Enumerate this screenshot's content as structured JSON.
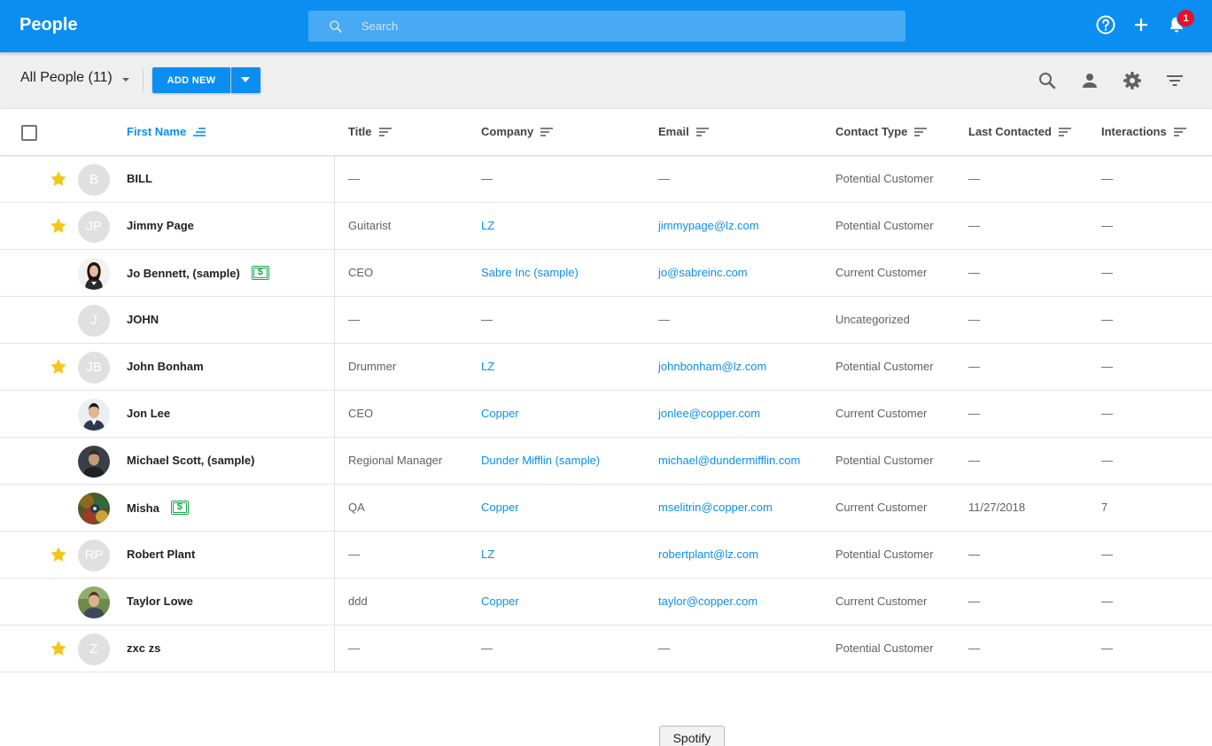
{
  "app": {
    "title": "People"
  },
  "search": {
    "placeholder": "Search"
  },
  "notifications": {
    "count": "1"
  },
  "toolbar": {
    "view_label": "All People (11)",
    "add_new_label": "ADD NEW"
  },
  "columns": {
    "first_name": "First Name",
    "title": "Title",
    "company": "Company",
    "email": "Email",
    "contact_type": "Contact Type",
    "last_contacted": "Last Contacted",
    "interactions": "Interactions"
  },
  "colors": {
    "brand": "#0b8ef2",
    "star": "#f5c518",
    "money": "#17a84a",
    "badge": "#e8102c"
  },
  "rows": [
    {
      "starred": true,
      "initials": "B",
      "photo": null,
      "name": "BILL",
      "deal": false,
      "title": "—",
      "company": "—",
      "email": "—",
      "contact_type": "Potential Customer",
      "last_contacted": "—",
      "interactions": "—"
    },
    {
      "starred": true,
      "initials": "JP",
      "photo": null,
      "name": "Jimmy Page",
      "deal": false,
      "title": "Guitarist",
      "company": "LZ",
      "email": "jimmypage@lz.com",
      "contact_type": "Potential Customer",
      "last_contacted": "—",
      "interactions": "—"
    },
    {
      "starred": false,
      "initials": "",
      "photo": "woman",
      "name": "Jo Bennett, (sample)",
      "deal": true,
      "title": "CEO",
      "company": "Sabre Inc (sample)",
      "email": "jo@sabreinc.com",
      "contact_type": "Current Customer",
      "last_contacted": "—",
      "interactions": "—"
    },
    {
      "starred": false,
      "initials": "J",
      "photo": null,
      "name": "JOHN",
      "deal": false,
      "title": "—",
      "company": "—",
      "email": "—",
      "contact_type": "Uncategorized",
      "last_contacted": "—",
      "interactions": "—"
    },
    {
      "starred": true,
      "initials": "JB",
      "photo": null,
      "name": "John Bonham",
      "deal": false,
      "title": "Drummer",
      "company": "LZ",
      "email": "johnbonham@lz.com",
      "contact_type": "Potential Customer",
      "last_contacted": "—",
      "interactions": "—"
    },
    {
      "starred": false,
      "initials": "",
      "photo": "man-suit",
      "name": "Jon Lee",
      "deal": false,
      "title": "CEO",
      "company": "Copper",
      "email": "jonlee@copper.com",
      "contact_type": "Current Customer",
      "last_contacted": "—",
      "interactions": "—"
    },
    {
      "starred": false,
      "initials": "",
      "photo": "man-dark",
      "name": "Michael Scott, (sample)",
      "deal": false,
      "title": "Regional Manager",
      "company": "Dunder Mifflin (sample)",
      "email": "michael@dundermifflin.com",
      "contact_type": "Potential Customer",
      "last_contacted": "—",
      "interactions": "—"
    },
    {
      "starred": false,
      "initials": "",
      "photo": "colorful",
      "name": "Misha",
      "deal": true,
      "title": "QA",
      "company": "Copper",
      "email": "mselitrin@copper.com",
      "contact_type": "Current Customer",
      "last_contacted": "11/27/2018",
      "interactions": "7"
    },
    {
      "starred": true,
      "initials": "RP",
      "photo": null,
      "name": "Robert Plant",
      "deal": false,
      "title": "—",
      "company": "LZ",
      "email": "robertplant@lz.com",
      "contact_type": "Potential Customer",
      "last_contacted": "—",
      "interactions": "—"
    },
    {
      "starred": false,
      "initials": "",
      "photo": "man-outdoor",
      "name": "Taylor Lowe",
      "deal": false,
      "title": "ddd",
      "company": "Copper",
      "email": "taylor@copper.com",
      "contact_type": "Current Customer",
      "last_contacted": "—",
      "interactions": "—"
    },
    {
      "starred": true,
      "initials": "Z",
      "photo": null,
      "name": "zxc zs",
      "deal": false,
      "title": "—",
      "company": "—",
      "email": "—",
      "contact_type": "Potential Customer",
      "last_contacted": "—",
      "interactions": "—"
    }
  ],
  "footer": {
    "spotify_label": "Spotify"
  }
}
